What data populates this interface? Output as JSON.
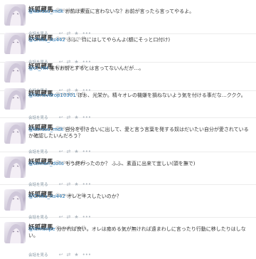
{
  "tweets": [
    {
      "name": "妖狐蔵馬",
      "handle": "@youko_mdk",
      "mention": "@karasu_mdk",
      "text": " お前は素直に言わないな？お前が言ったら言ってやるよ。",
      "conversation": "会話を見る"
    },
    {
      "name": "妖狐蔵馬",
      "handle": "@youko_mdk",
      "mention": "@Chika_As442",
      "text": " ふふ、口にはしてやらんよ(額にそっと口付け)",
      "conversation": "会話を見る"
    },
    {
      "name": "妖狐蔵馬",
      "handle": "@youko_mdk",
      "mention": "@ct_HH",
      "text": " 誰もお前とするとは言ってないんだが…。",
      "conversation": "会話を見る"
    },
    {
      "name": "妖狐蔵馬",
      "handle": "@youko_mdk",
      "mention": "@honevdrop10301",
      "text": " ほぉ、光栄か。精々オレの機嫌を損ねないよう気を付ける事だな…ククク。",
      "conversation": "会話を見る"
    },
    {
      "name": "妖狐蔵馬",
      "handle": "@youko_mdk",
      "mention": "@karasu_mdk",
      "text": " 自分を引き合いに出して、愛と言う言葉を発する奴はだいたい自分が愛されているか確認したいんだろう？",
      "conversation": "会話を見る"
    },
    {
      "name": "妖狐蔵馬",
      "handle": "@youko_mdk",
      "mention": "@temari_dolls",
      "text": " もう終わったのか？ ふふ、素直に出来て宜しい(頭を撫で)",
      "conversation": "会話を見る"
    },
    {
      "name": "妖狐蔵馬",
      "handle": "@youko_mdk",
      "mention": "@Chika_As442",
      "text": " オレとキスしたいのか？",
      "conversation": "会話を見る"
    },
    {
      "name": "妖狐蔵馬",
      "handle": "@youko_mdk",
      "mention": "@lemonpe",
      "text": " 分かれば良い。オレは癒める気が無ければ遠まわしに言ったり行動に移したりはしない。",
      "conversation": "会話を見る"
    }
  ],
  "icons": [
    "reply-icon",
    "retweet-icon",
    "favorite-icon",
    "more-icon"
  ],
  "colors": {
    "link": "#2b7bb9",
    "meta": "#999999",
    "divider": "#ececec"
  }
}
